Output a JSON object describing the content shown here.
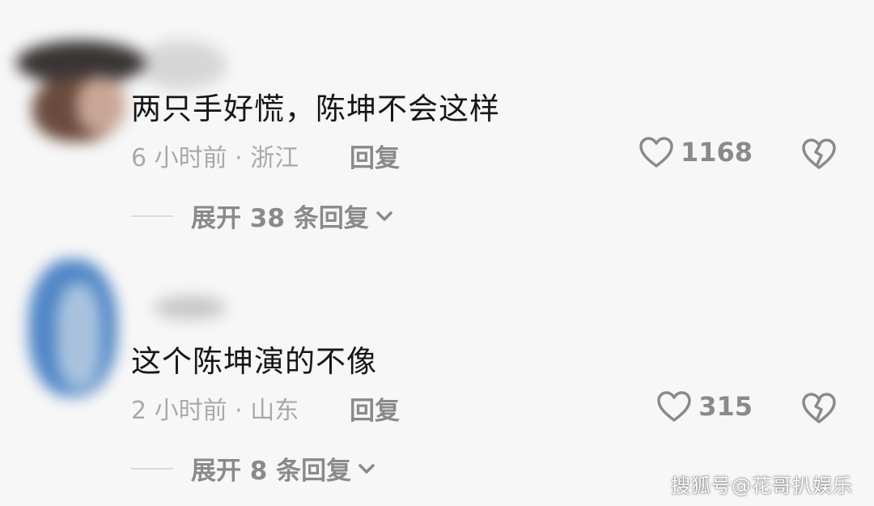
{
  "comments": [
    {
      "text": "两只手好慌，陈坤不会这样",
      "meta": "6 小时前 · 浙江",
      "reply_label": "回复",
      "likes": "1168",
      "expand_label": "展开 38 条回复"
    },
    {
      "text": "这个陈坤演的不像",
      "meta": "2 小时前 · 山东",
      "reply_label": "回复",
      "likes": "315",
      "expand_label": "展开 8 条回复"
    }
  ],
  "watermark": "搜狐号@花哥扒娱乐",
  "icons": {
    "like": "heart-outline-icon",
    "dislike": "broken-heart-icon",
    "expand": "chevron-down-icon"
  },
  "colors": {
    "background": "#f7f7f7",
    "text_primary": "#161616",
    "text_secondary": "#a9a9a9",
    "icon": "#8a8a8a"
  }
}
